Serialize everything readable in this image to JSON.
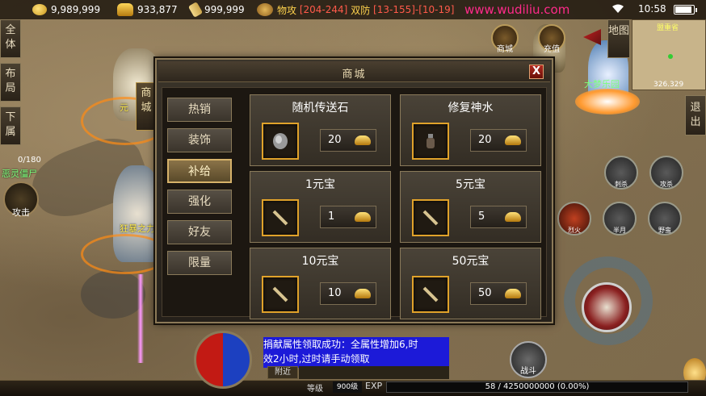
{
  "topbar": {
    "gold": "9,989,999",
    "ingots": "933,877",
    "scroll_currency": "999,999",
    "atk_label": "物攻",
    "atk_range": "[204-244]",
    "def_label": "双防",
    "def_range": "[13-155]-[10-19]",
    "watermark": "www.wudiliu.com",
    "time": "10:58"
  },
  "left_buttons": [
    "全体",
    "布局",
    "下属"
  ],
  "left_labels": {
    "hp_count": "0/180",
    "monster_name": "恶灵僵尸",
    "attack_label": "攻击",
    "char_name_1": "元",
    "char_name_2": "狂暴之力"
  },
  "right_top": {
    "shop_label": "商城",
    "activity_label": "充值",
    "map_label": "地图",
    "minimap_name": "盟重省",
    "minimap_coord": "326.329",
    "exit_label": "退出",
    "npc_name": "大梦乐园"
  },
  "skills": [
    "刺杀",
    "攻杀",
    "烈火",
    "半月",
    "野蛮"
  ],
  "battle_label": "战斗",
  "shop": {
    "title": "商城",
    "close": "X",
    "tabs": [
      "热销",
      "装饰",
      "补给",
      "强化",
      "好友",
      "限量"
    ],
    "active_tab": "补给",
    "items": [
      {
        "name": "随机传送石",
        "price": "20",
        "icon": "stone-icon"
      },
      {
        "name": "修复神水",
        "price": "20",
        "icon": "potion-icon"
      },
      {
        "name": "1元宝",
        "price": "1",
        "icon": "scroll-icon"
      },
      {
        "name": "5元宝",
        "price": "5",
        "icon": "scroll-icon"
      },
      {
        "name": "10元宝",
        "price": "10",
        "icon": "scroll-icon"
      },
      {
        "name": "50元宝",
        "price": "50",
        "icon": "scroll-icon"
      }
    ],
    "vertical_tab": "商城"
  },
  "chat": {
    "line1": "捐献属性领取成功：全属性增加6,时",
    "line2": "效2小时,过时请手动领取",
    "tab_recent": "附近"
  },
  "bottom": {
    "level_label": "等级",
    "level_value": "900级",
    "exp_label": "EXP",
    "exp_value": "58 / 4250000000 (0.00%)"
  },
  "colors": {
    "accent_gold": "#e0a22a",
    "active_tab": "#d6b26a",
    "chat_bg": "#1c1ad8",
    "watermark": "#ff2a8a"
  }
}
